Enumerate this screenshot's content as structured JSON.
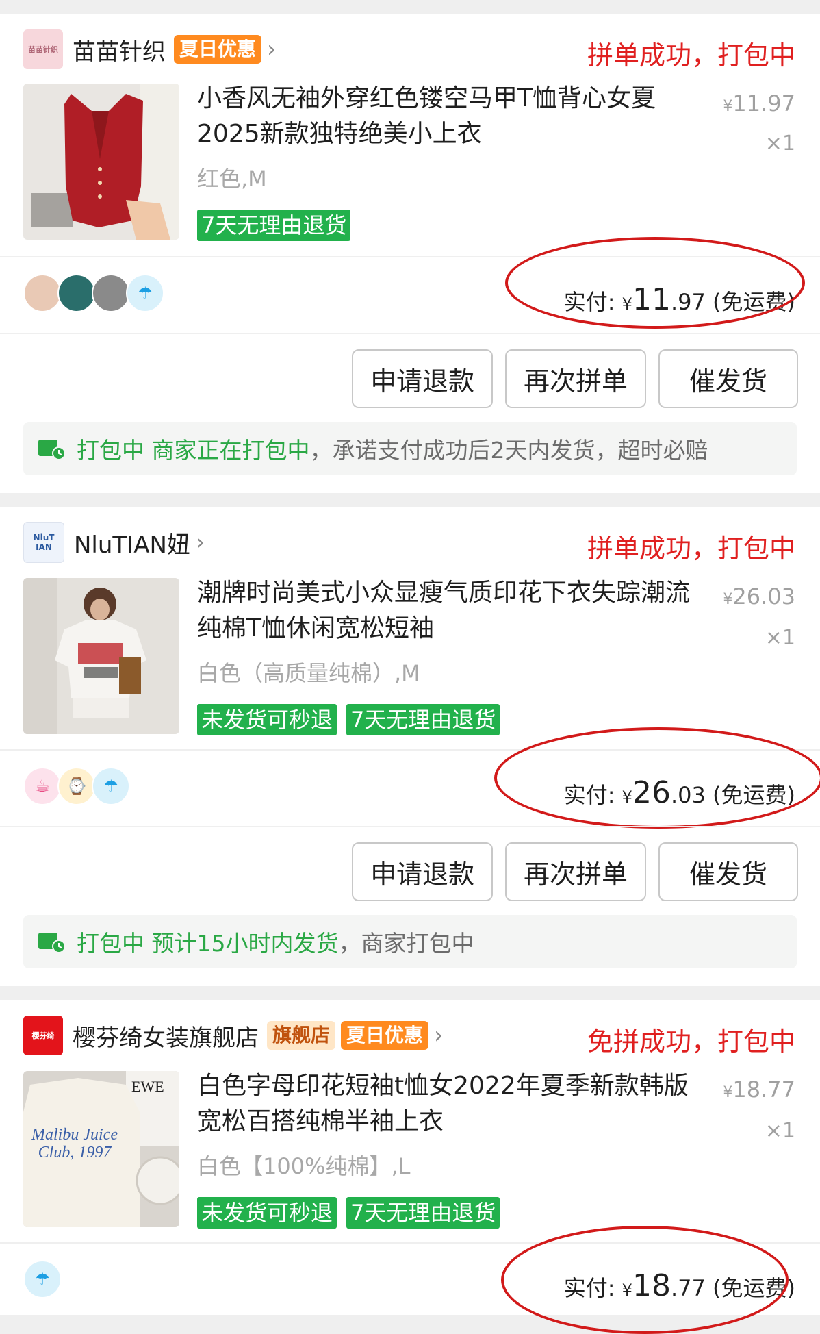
{
  "orders": [
    {
      "shop_name": "苗苗针织",
      "shop_logo_text": "苗苗针织",
      "tags": [
        "夏日优惠"
      ],
      "status": "拼单成功，打包中",
      "product_title": "小香风无袖外穿红色镂空马甲T恤背心女夏2025新款独特绝美小上衣",
      "price": "11.97",
      "qty": "×1",
      "variant": "红色,M",
      "badges": [
        "7天无理由退货"
      ],
      "paid_label": "实付:",
      "paid_yen": "¥",
      "paid_int": "11",
      "paid_dec": ".97",
      "paid_note": "(免运费)",
      "buttons": [
        "申请退款",
        "再次拼单",
        "催发货"
      ],
      "notice_green": "打包中 商家正在打包中",
      "notice_grey": "，承诺支付成功后2天内发货，超时必赔"
    },
    {
      "shop_name": "NluTIAN妞",
      "shop_logo_text": "NluT IAN",
      "tags": [],
      "status": "拼单成功，打包中",
      "product_title": "潮牌时尚美式小众显瘦气质印花下衣失踪潮流纯棉T恤休闲宽松短袖",
      "price": "26.03",
      "qty": "×1",
      "variant": "白色（高质量纯棉）,M",
      "badges": [
        "未发货可秒退",
        "7天无理由退货"
      ],
      "paid_label": "实付:",
      "paid_yen": "¥",
      "paid_int": "26",
      "paid_dec": ".03",
      "paid_note": "(免运费)",
      "buttons": [
        "申请退款",
        "再次拼单",
        "催发货"
      ],
      "notice_green": "打包中 预计15小时内发货",
      "notice_grey": "，商家打包中"
    },
    {
      "shop_name": "樱芬绮女装旗舰店",
      "shop_logo_text": "樱芬绮",
      "tags": [
        "旗舰店",
        "夏日优惠"
      ],
      "status": "免拼成功，打包中",
      "product_title": "白色字母印花短袖t恤女2022年夏季新款韩版宽松百搭纯棉半袖上衣",
      "price": "18.77",
      "qty": "×1",
      "variant": "白色【100%纯棉】,L",
      "badges": [
        "未发货可秒退",
        "7天无理由退货"
      ],
      "paid_label": "实付:",
      "paid_yen": "¥",
      "paid_int": "18",
      "paid_dec": ".77",
      "paid_note": "(免运费)",
      "shirt_print": "Malibu Juice Club, 1997"
    }
  ],
  "icons": {
    "chevron": "chevron-right-icon",
    "truck": "delivery-truck-icon",
    "umbrella": "umbrella-icon"
  },
  "colors": {
    "status_red": "#e02020",
    "badge_green": "#22b14c",
    "tag_orange": "#ff8a1f",
    "annotation_ring": "#d21a1a"
  }
}
